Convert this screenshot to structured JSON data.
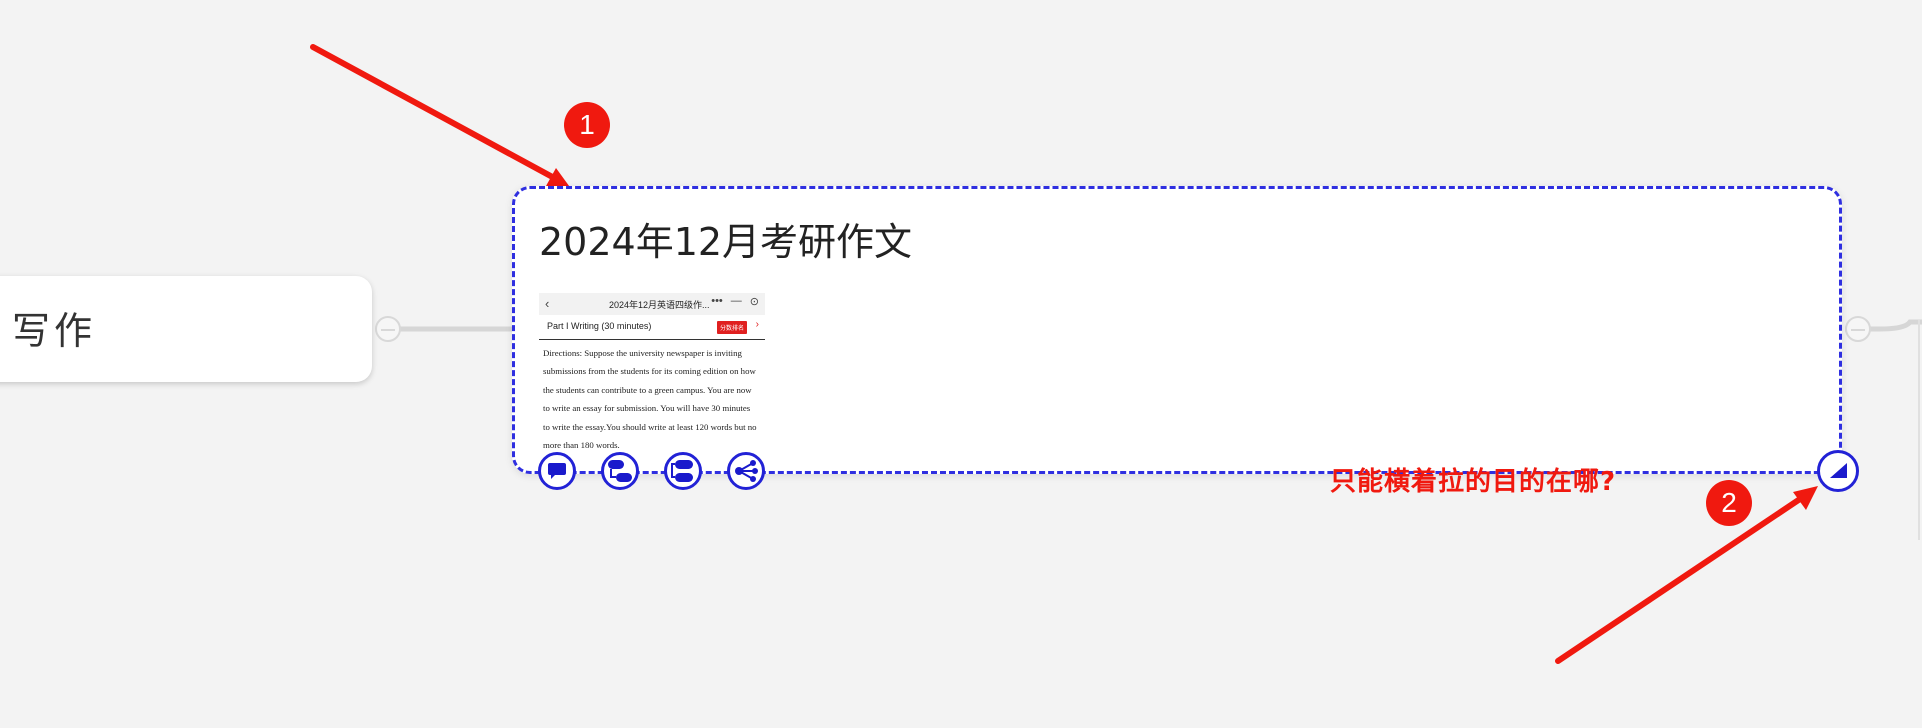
{
  "left_node": {
    "label": "写作"
  },
  "selected_node": {
    "title": "2024年12月考研作文",
    "thumbnail": {
      "header_title": "2024年12月英语四级作...",
      "part_label": "Part I Writing (30 minutes)",
      "badge_label": "分数排名",
      "body_lines": [
        "Directions: Suppose the university newspaper is inviting",
        "submissions from the students for its coming edition on how",
        "the students can contribute to a green campus. You are now",
        "to write an essay for submission. You will have 30 minutes",
        "to write the essay.You should write at least 120 words but no",
        "more than 180 words."
      ]
    },
    "toolbar": {
      "tools": [
        {
          "icon": "comment-icon"
        },
        {
          "icon": "add-subtopic-icon"
        },
        {
          "icon": "add-sibling-icon"
        },
        {
          "icon": "share-branch-icon"
        }
      ]
    },
    "resize_icon": "resize-triangle-icon"
  },
  "annotations": {
    "marker_1": "1",
    "marker_2": "2",
    "question": "只能横着拉的目的在哪?"
  },
  "colors": {
    "selection": "#2f2fe0",
    "annotation": "#f0190f",
    "canvas": "#f3f3f3"
  }
}
